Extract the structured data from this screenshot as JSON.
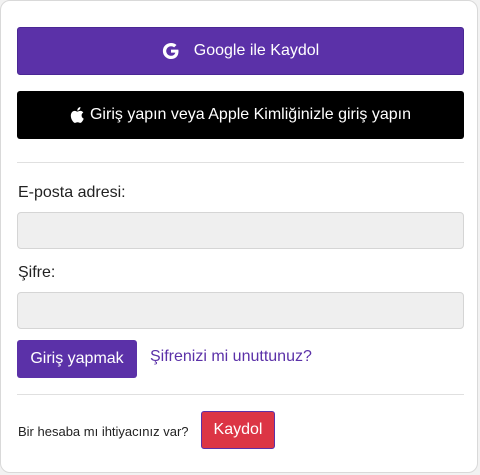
{
  "social": {
    "google_label": "Google ile Kaydol",
    "apple_label": "Giriş yapın veya Apple Kimliğinizle giriş yapın"
  },
  "form": {
    "email_label": "E-posta adresi:",
    "email_value": "",
    "password_label": "Şifre:",
    "password_value": "",
    "login_label": "Giriş yapmak",
    "forgot_label": "Şifrenizi mi unuttunuz?"
  },
  "signup": {
    "prompt": "Bir hesaba mı ihtiyacınız var?",
    "button_label": "Kaydol"
  },
  "colors": {
    "accent": "#5b31a8",
    "apple": "#000000",
    "signup": "#dc3545"
  },
  "icons": {
    "google": "google-icon",
    "apple": "apple-icon"
  }
}
